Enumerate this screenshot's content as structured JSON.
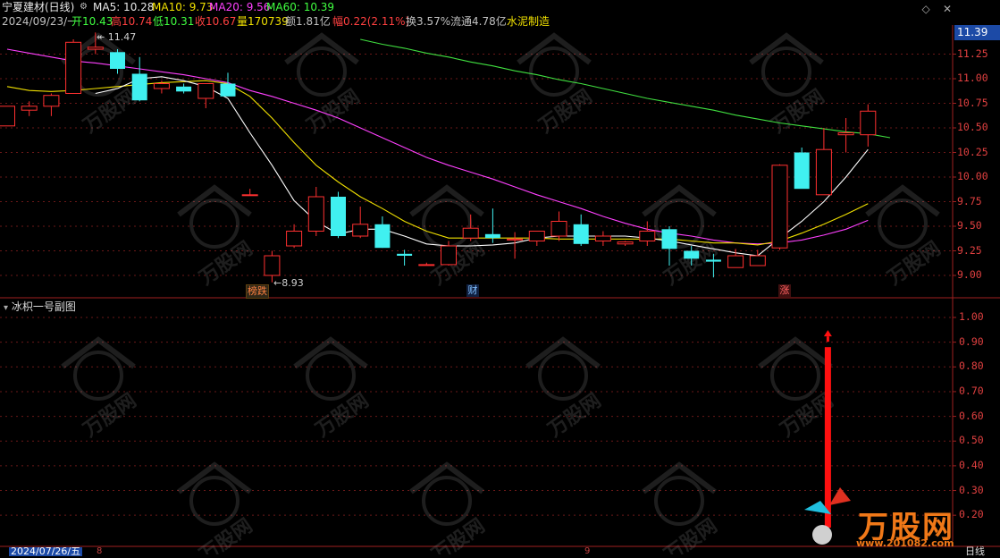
{
  "header": {
    "stock_name": "宁夏建材(日线)",
    "ma5": "MA5: 10.28",
    "ma10": "MA10: 9.73",
    "ma20": "MA20: 9.56",
    "ma60": "MA60: 10.39",
    "date": "2024/09/23/一",
    "open": "开10.43",
    "high": "高10.74",
    "low": "低10.31",
    "close": "收10.67",
    "volume": "量170739",
    "amount": "额1.81亿",
    "change": "幅0.22(2.11%)",
    "turnover": "换3.57%",
    "float_cap": "流通4.78亿",
    "sector": "水泥制造"
  },
  "price_badge": "11.39",
  "price_axis": [
    "11.25",
    "11.00",
    "10.75",
    "10.50",
    "10.25",
    "10.00",
    "9.75",
    "9.50",
    "9.25",
    "9.00"
  ],
  "annotations": {
    "high_label": "11.47",
    "low_label": "8.93"
  },
  "events": {
    "e1": "榜跌",
    "e2": "财",
    "e3": "涨"
  },
  "sub_panel": {
    "title": "冰枳一号副图",
    "axis": [
      "1.00",
      "0.90",
      "0.80",
      "0.70",
      "0.60",
      "0.50",
      "0.40",
      "0.30",
      "0.20"
    ]
  },
  "footer": {
    "date_label": "2024/07/26/五",
    "tick_a": "8",
    "tick_b": "9",
    "period": "日线"
  },
  "watermark": {
    "brand": "万股网",
    "url": "www.201082.com"
  },
  "colors": {
    "up": "#ff3030",
    "down": "#40f0f0",
    "ma5": "#ffffff",
    "ma10": "#f0e000",
    "ma20": "#ff40ff",
    "ma60": "#40e040",
    "signal": "#ff1010"
  },
  "chart_data": {
    "type": "candlestick",
    "ylim": [
      8.85,
      11.45
    ],
    "candles": [
      {
        "o": 10.52,
        "h": 10.72,
        "l": 10.52,
        "c": 10.72
      },
      {
        "o": 10.68,
        "h": 10.77,
        "l": 10.62,
        "c": 10.72
      },
      {
        "o": 10.72,
        "h": 10.85,
        "l": 10.62,
        "c": 10.83
      },
      {
        "o": 10.85,
        "h": 11.4,
        "l": 10.85,
        "c": 11.37
      },
      {
        "o": 11.3,
        "h": 11.47,
        "l": 11.25,
        "c": 11.32
      },
      {
        "o": 11.27,
        "h": 11.3,
        "l": 11.05,
        "c": 11.1
      },
      {
        "o": 11.05,
        "h": 11.22,
        "l": 10.77,
        "c": 10.78
      },
      {
        "o": 10.9,
        "h": 10.98,
        "l": 10.85,
        "c": 10.95
      },
      {
        "o": 10.92,
        "h": 10.95,
        "l": 10.85,
        "c": 10.87
      },
      {
        "o": 10.8,
        "h": 10.95,
        "l": 10.7,
        "c": 10.95
      },
      {
        "o": 10.95,
        "h": 11.06,
        "l": 10.82,
        "c": 10.82
      },
      {
        "o": 9.82,
        "h": 9.88,
        "l": 9.82,
        "c": 9.82
      },
      {
        "o": 9.0,
        "h": 9.25,
        "l": 8.93,
        "c": 9.2
      },
      {
        "o": 9.3,
        "h": 9.52,
        "l": 9.28,
        "c": 9.45
      },
      {
        "o": 9.45,
        "h": 9.9,
        "l": 9.4,
        "c": 9.8
      },
      {
        "o": 9.8,
        "h": 9.85,
        "l": 9.38,
        "c": 9.4
      },
      {
        "o": 9.4,
        "h": 9.7,
        "l": 9.38,
        "c": 9.52
      },
      {
        "o": 9.52,
        "h": 9.6,
        "l": 9.28,
        "c": 9.28
      },
      {
        "o": 9.22,
        "h": 9.26,
        "l": 9.1,
        "c": 9.2
      },
      {
        "o": 9.11,
        "h": 9.13,
        "l": 9.1,
        "c": 9.11
      },
      {
        "o": 9.11,
        "h": 9.35,
        "l": 9.1,
        "c": 9.3
      },
      {
        "o": 9.38,
        "h": 9.62,
        "l": 9.35,
        "c": 9.48
      },
      {
        "o": 9.42,
        "h": 9.68,
        "l": 9.33,
        "c": 9.38
      },
      {
        "o": 9.36,
        "h": 9.44,
        "l": 9.17,
        "c": 9.37
      },
      {
        "o": 9.35,
        "h": 9.45,
        "l": 9.3,
        "c": 9.45
      },
      {
        "o": 9.4,
        "h": 9.65,
        "l": 9.35,
        "c": 9.55
      },
      {
        "o": 9.52,
        "h": 9.62,
        "l": 9.3,
        "c": 9.32
      },
      {
        "o": 9.35,
        "h": 9.45,
        "l": 9.3,
        "c": 9.4
      },
      {
        "o": 9.32,
        "h": 9.35,
        "l": 9.3,
        "c": 9.34
      },
      {
        "o": 9.35,
        "h": 9.55,
        "l": 9.3,
        "c": 9.45
      },
      {
        "o": 9.47,
        "h": 9.5,
        "l": 9.1,
        "c": 9.27
      },
      {
        "o": 9.25,
        "h": 9.3,
        "l": 9.1,
        "c": 9.17
      },
      {
        "o": 9.16,
        "h": 9.22,
        "l": 8.98,
        "c": 9.14
      },
      {
        "o": 9.08,
        "h": 9.27,
        "l": 9.08,
        "c": 9.2
      },
      {
        "o": 9.1,
        "h": 9.26,
        "l": 9.1,
        "c": 9.2
      },
      {
        "o": 9.28,
        "h": 10.13,
        "l": 9.26,
        "c": 10.12
      },
      {
        "o": 10.25,
        "h": 10.3,
        "l": 9.9,
        "c": 9.88
      },
      {
        "o": 9.82,
        "h": 10.5,
        "l": 9.82,
        "c": 10.28
      },
      {
        "o": 10.43,
        "h": 10.6,
        "l": 10.25,
        "c": 10.45
      },
      {
        "o": 10.43,
        "h": 10.74,
        "l": 10.31,
        "c": 10.67
      }
    ],
    "ma5": [
      null,
      null,
      null,
      null,
      10.85,
      10.9,
      11.0,
      11.02,
      10.98,
      10.92,
      10.8,
      10.45,
      10.12,
      9.76,
      9.55,
      9.42,
      9.47,
      9.47,
      9.4,
      9.32,
      9.3,
      9.3,
      9.31,
      9.33,
      9.38,
      9.4,
      9.4,
      9.4,
      9.4,
      9.38,
      9.35,
      9.31,
      9.27,
      9.23,
      9.2,
      9.38,
      9.55,
      9.75,
      10.0,
      10.28
    ],
    "ma10": [
      10.92,
      10.88,
      10.87,
      10.88,
      10.9,
      10.92,
      10.94,
      10.96,
      10.97,
      10.98,
      10.95,
      10.82,
      10.6,
      10.35,
      10.12,
      9.95,
      9.8,
      9.68,
      9.55,
      9.45,
      9.38,
      9.38,
      9.38,
      9.38,
      9.38,
      9.37,
      9.37,
      9.37,
      9.37,
      9.37,
      9.37,
      9.35,
      9.33,
      9.33,
      9.31,
      9.35,
      9.43,
      9.52,
      9.62,
      9.73
    ],
    "ma20": [
      11.3,
      11.26,
      11.22,
      11.18,
      11.16,
      11.13,
      11.1,
      11.07,
      11.04,
      11.0,
      10.96,
      10.88,
      10.82,
      10.75,
      10.68,
      10.6,
      10.5,
      10.4,
      10.3,
      10.2,
      10.12,
      10.05,
      9.98,
      9.9,
      9.82,
      9.75,
      9.68,
      9.6,
      9.53,
      9.47,
      9.43,
      9.4,
      9.36,
      9.33,
      9.32,
      9.33,
      9.36,
      9.41,
      9.47,
      9.56
    ],
    "ma60_segment": {
      "from_index": 16,
      "values": [
        11.4,
        11.35,
        11.31,
        11.26,
        11.22,
        11.17,
        11.13,
        11.08,
        11.04,
        10.99,
        10.95,
        10.9,
        10.85,
        10.8,
        10.76,
        10.72,
        10.68,
        10.63,
        10.59,
        10.55,
        10.52,
        10.49,
        10.46,
        10.44,
        10.4
      ]
    },
    "sub_ylim": [
      0.15,
      1.05
    ],
    "signal_bar": {
      "index": 37,
      "value": 0.88
    }
  }
}
